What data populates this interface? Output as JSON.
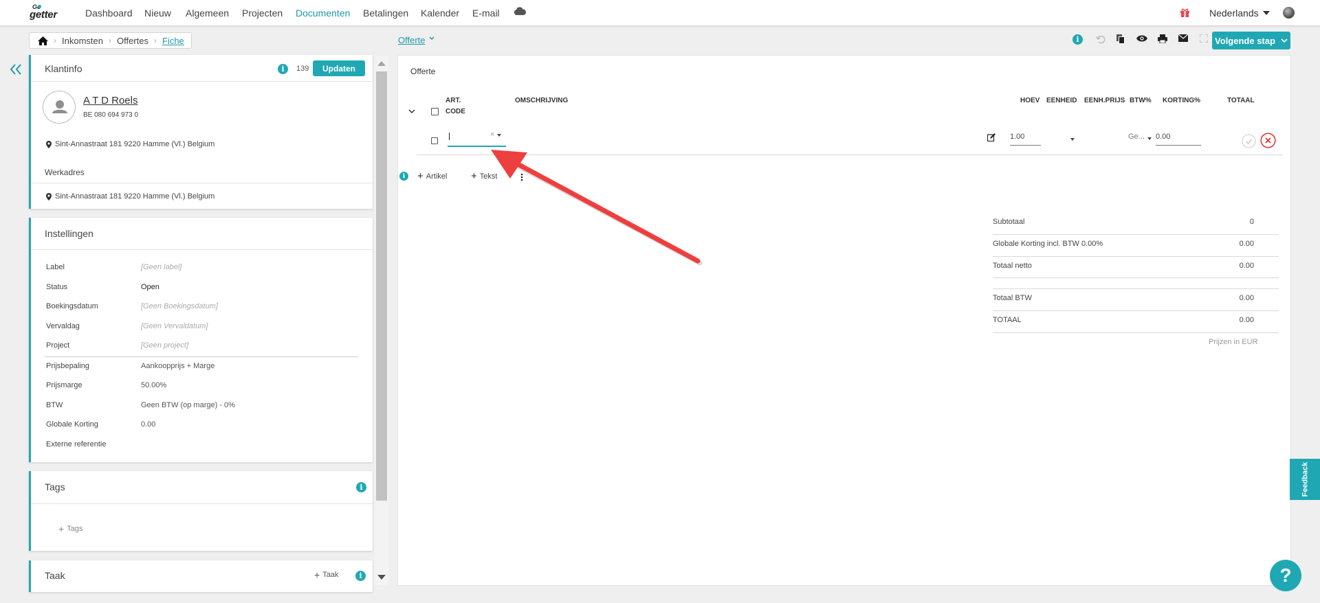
{
  "brand": {
    "logo_small": "Go",
    "logo_main": "getter",
    "accent": "#1fa8b3",
    "brand_color": "#1f9aa6",
    "danger": "#e0302a"
  },
  "nav": {
    "items": [
      "Dashboard",
      "Nieuw",
      "Algemeen",
      "Projecten",
      "Documenten",
      "Betalingen",
      "Kalender",
      "E-mail"
    ],
    "active": "Documenten",
    "language": "Nederlands"
  },
  "breadcrumb": [
    "Inkomsten",
    "Offertes",
    "Fiche"
  ],
  "doc_type": "Offerte",
  "toolbar": {
    "next_step_label": "Volgende stap"
  },
  "klantinfo": {
    "title": "Klantinfo",
    "count": "139",
    "update_label": "Updaten",
    "name": "A T D Roels",
    "vat": "BE 080 694 973 0",
    "address": "Sint-Annastraat 181 9220 Hamme (Vl.) Belgium",
    "werkadres_label": "Werkadres",
    "werkadres": "Sint-Annastraat 181 9220 Hamme (Vl.) Belgium"
  },
  "instellingen": {
    "title": "Instellingen",
    "rows": [
      {
        "label": "Label",
        "value": "[Geen label]"
      },
      {
        "label": "Status",
        "value": "Open"
      },
      {
        "label": "Boekingsdatum",
        "value": "[Geen Boekingsdatum]"
      },
      {
        "label": "Vervaldag",
        "value": "[Geen Vervaldatum]"
      },
      {
        "label": "Project",
        "value": "[Geen project]"
      },
      {
        "label": "Prijsbepaling",
        "value": "Aankoopprijs + Marge"
      },
      {
        "label": "Prijsmarge",
        "value": "50.00%"
      },
      {
        "label": "BTW",
        "value": "Geen BTW (op marge) - 0%"
      },
      {
        "label": "Globale Korting",
        "value": "0.00"
      },
      {
        "label": "Externe referentie",
        "value": ""
      }
    ]
  },
  "tags": {
    "title": "Tags",
    "add_label": "Tags"
  },
  "taak": {
    "title": "Taak",
    "add_label": "Taak"
  },
  "offerte": {
    "title": "Offerte",
    "columns": {
      "art1": "ART.",
      "art2": "CODE",
      "omschrijving": "OMSCHRIJVING",
      "hoev": "HOEV",
      "eenheid": "EENHEID",
      "eenhprijs": "EENH.PRIJS",
      "btw": "BTW%",
      "korting": "KORTING%",
      "totaal": "TOTAAL"
    },
    "line": {
      "art_code": "",
      "hoev": "1.00",
      "btw": "Ge...",
      "korting": "0.00"
    },
    "add_artikel": "Artikel",
    "add_tekst": "Tekst",
    "totals": [
      {
        "label": "Subtotaal",
        "value": "0"
      },
      {
        "label": "Globale Korting incl. BTW 0.00%",
        "value": "0.00"
      },
      {
        "label": "Totaal netto",
        "value": "0.00"
      },
      {
        "label": "Totaal BTW",
        "value": "0.00"
      },
      {
        "label": "TOTAAL",
        "value": "0.00"
      }
    ],
    "currency_note": "Prijzen in EUR"
  },
  "feedback_label": "Feedback",
  "help_label": "?"
}
